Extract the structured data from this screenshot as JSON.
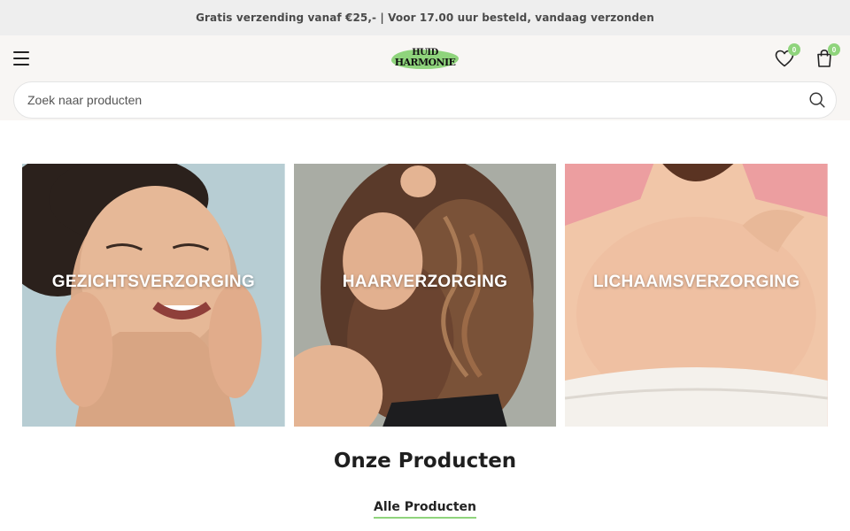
{
  "announcement": "Gratis verzending vanaf €25,- | Voor 17.00 uur besteld, vandaag verzonden",
  "header": {
    "logo": {
      "line1": "HUID",
      "line2": "HARMONIE"
    },
    "wishlist_count": "0",
    "cart_count": "0",
    "menu_icon": "hamburger-menu-icon",
    "wishlist_icon": "heart-icon",
    "cart_icon": "shopping-bag-icon"
  },
  "search": {
    "placeholder": "Zoek naar producten",
    "icon": "search-icon"
  },
  "categories": [
    {
      "label": "GEZICHTSVERZORGING",
      "image": "woman smiling touching face"
    },
    {
      "label": "HAARVERZORGING",
      "image": "woman with long wavy brown hair"
    },
    {
      "label": "LICHAAMSVERZORGING",
      "image": "bare shoulders and back on pink background"
    }
  ],
  "products_section": {
    "title": "Onze Producten",
    "link": "Alle Producten"
  },
  "colors": {
    "accent": "#8fd47c",
    "header_bg": "#f8f6f4",
    "announcement_bg": "#eeeeee"
  }
}
